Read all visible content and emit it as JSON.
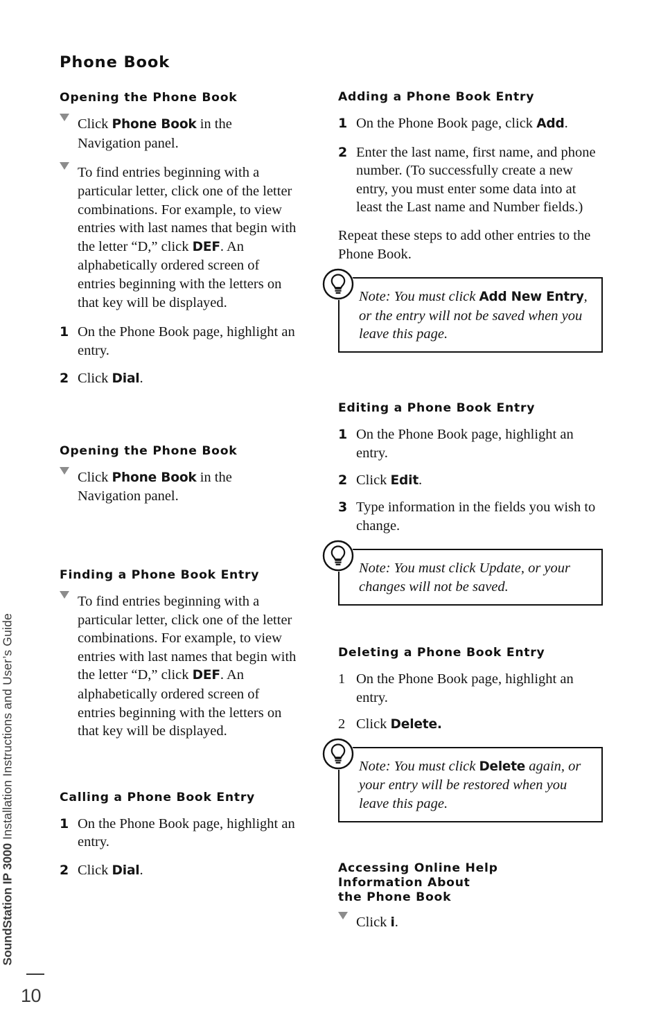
{
  "page": {
    "folio": "10",
    "spine_brand": "SoundStation IP 3000",
    "spine_subtitle": " Installation Instructions and User’s Guide"
  },
  "title": "Phone Book",
  "left_column": {
    "sections": [
      {
        "heading": "Opening the Phone Book",
        "items": [
          {
            "marker": "triangle",
            "parts": [
              {
                "text": "Click ",
                "style": "normal"
              },
              {
                "text": "Phone Book",
                "style": "ui"
              },
              {
                "text": " in the Navigation panel.",
                "style": "normal"
              }
            ]
          },
          {
            "marker": "triangle",
            "parts": [
              {
                "text": "To find entries beginning with a particular letter, click one of the letter combinations. For example, to view entries with last names that begin with the letter “D,” click ",
                "style": "normal"
              },
              {
                "text": "DEF",
                "style": "ui"
              },
              {
                "text": ". An alphabetically ordered screen of entries beginning with the letters on that key will be displayed.",
                "style": "normal"
              }
            ]
          },
          {
            "marker": "1",
            "marker_style": "bold",
            "parts": [
              {
                "text": "On the Phone Book page, highlight an entry.",
                "style": "normal"
              }
            ]
          },
          {
            "marker": "2",
            "marker_style": "bold",
            "parts": [
              {
                "text": "Click ",
                "style": "normal"
              },
              {
                "text": "Dial",
                "style": "ui"
              },
              {
                "text": ".",
                "style": "normal"
              }
            ]
          }
        ]
      },
      {
        "heading": "Opening the Phone Book",
        "items": [
          {
            "marker": "triangle",
            "parts": [
              {
                "text": "Click ",
                "style": "normal"
              },
              {
                "text": "Phone Book",
                "style": "ui"
              },
              {
                "text": " in the Navigation panel.",
                "style": "normal"
              }
            ]
          }
        ]
      },
      {
        "heading": "Finding a Phone Book Entry",
        "items": [
          {
            "marker": "triangle",
            "parts": [
              {
                "text": "To find entries beginning with a particular letter, click one of the letter combinations. For example, to view entries with last names that begin with the letter “D,” click ",
                "style": "normal"
              },
              {
                "text": "DEF",
                "style": "ui"
              },
              {
                "text": ". An alphabetically ordered screen of entries beginning with the letters on that key will be displayed.",
                "style": "normal"
              }
            ]
          }
        ]
      },
      {
        "heading": "Calling a Phone Book Entry",
        "items": [
          {
            "marker": "1",
            "marker_style": "bold",
            "parts": [
              {
                "text": "On the Phone Book page, highlight an entry.",
                "style": "normal"
              }
            ]
          },
          {
            "marker": "2",
            "marker_style": "bold",
            "parts": [
              {
                "text": "Click ",
                "style": "normal"
              },
              {
                "text": "Dial",
                "style": "ui"
              },
              {
                "text": ".",
                "style": "normal"
              }
            ]
          }
        ]
      }
    ]
  },
  "right_column": {
    "sections": [
      {
        "heading": "Adding a Phone Book Entry",
        "items": [
          {
            "marker": "1",
            "marker_style": "bold",
            "parts": [
              {
                "text": "On the Phone Book page, click ",
                "style": "normal"
              },
              {
                "text": "Add",
                "style": "ui"
              },
              {
                "text": ".",
                "style": "normal"
              }
            ]
          },
          {
            "marker": "2",
            "marker_style": "bold",
            "parts": [
              {
                "text": "Enter the last name, first name, and phone number. (To successfully create a new entry, you must enter some data into at least the Last name and Number fields.)",
                "style": "normal"
              }
            ]
          }
        ],
        "trailing_paragraph": "Repeat these steps to add other entries to the Phone Book.",
        "note": {
          "icon": "lightbulb-icon",
          "parts": [
            {
              "text": "Note: You must click ",
              "style": "italic"
            },
            {
              "text": "Add New Entry",
              "style": "ui"
            },
            {
              "text": ", or the entry will not be saved when you leave this page.",
              "style": "italic"
            }
          ]
        }
      },
      {
        "heading": "Editing a Phone Book Entry",
        "items": [
          {
            "marker": "1",
            "marker_style": "bold",
            "parts": [
              {
                "text": "On the Phone Book page, highlight an entry.",
                "style": "normal"
              }
            ]
          },
          {
            "marker": "2",
            "marker_style": "bold",
            "parts": [
              {
                "text": "Click ",
                "style": "normal"
              },
              {
                "text": "Edit",
                "style": "ui"
              },
              {
                "text": ".",
                "style": "normal"
              }
            ]
          },
          {
            "marker": "3",
            "marker_style": "bold",
            "parts": [
              {
                "text": "Type information in the fields you wish to change.",
                "style": "normal"
              }
            ]
          }
        ],
        "note": {
          "icon": "lightbulb-icon",
          "parts": [
            {
              "text": "Note: You must click Update, or your changes will not be saved.",
              "style": "italic"
            }
          ]
        }
      },
      {
        "heading": "Deleting a Phone Book Entry",
        "items": [
          {
            "marker": "1",
            "marker_style": "serif",
            "parts": [
              {
                "text": "On the Phone Book page, highlight an entry.",
                "style": "normal"
              }
            ]
          },
          {
            "marker": "2",
            "marker_style": "serif",
            "parts": [
              {
                "text": "Click ",
                "style": "normal"
              },
              {
                "text": "Delete.",
                "style": "ui"
              }
            ]
          }
        ],
        "note": {
          "icon": "lightbulb-icon",
          "parts": [
            {
              "text": "Note: You must click ",
              "style": "italic"
            },
            {
              "text": "Delete",
              "style": "ui"
            },
            {
              "text": " again, or your entry will be restored when you leave this page.",
              "style": "italic"
            }
          ]
        }
      },
      {
        "heading": "Accessing Online Help\nInformation About\nthe Phone Book",
        "items": [
          {
            "marker": "triangle",
            "parts": [
              {
                "text": "Click ",
                "style": "normal"
              },
              {
                "text": "i",
                "style": "ui"
              },
              {
                "text": ".",
                "style": "normal"
              }
            ]
          }
        ]
      }
    ]
  }
}
